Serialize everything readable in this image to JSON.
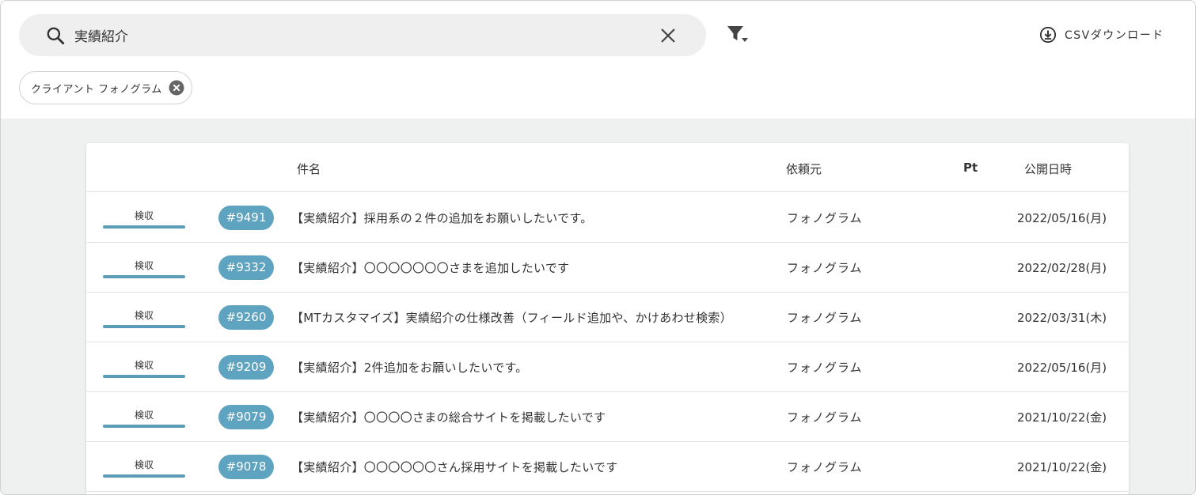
{
  "search": {
    "value": "実績紹介",
    "icon": "search-icon",
    "clear_icon": "close-icon"
  },
  "filter": {
    "icon": "filter-icon"
  },
  "csv": {
    "label": "CSVダウンロード",
    "icon": "download-circle-icon"
  },
  "chips": [
    {
      "label": "クライアント フォノグラム",
      "close_icon": "cancel-circle-icon"
    }
  ],
  "table": {
    "headers": {
      "name": "件名",
      "client": "依頼元",
      "pt": "Pt",
      "date": "公開日時"
    },
    "rows": [
      {
        "status": "検収",
        "id": "#9491",
        "title": "【実績紹介】採用系の２件の追加をお願いしたいです。",
        "client": "フォノグラム",
        "pt": "",
        "date": "2022/05/16(月)"
      },
      {
        "status": "検収",
        "id": "#9332",
        "title": "【実績紹介】〇〇〇〇〇〇〇さまを追加したいです",
        "client": "フォノグラム",
        "pt": "",
        "date": "2022/02/28(月)"
      },
      {
        "status": "検収",
        "id": "#9260",
        "title": "【MTカスタマイズ】実績紹介の仕様改善（フィールド追加や、かけあわせ検索）",
        "client": "フォノグラム",
        "pt": "",
        "date": "2022/03/31(木)"
      },
      {
        "status": "検収",
        "id": "#9209",
        "title": "【実績紹介】2件追加をお願いしたいです。",
        "client": "フォノグラム",
        "pt": "",
        "date": "2022/05/16(月)"
      },
      {
        "status": "検収",
        "id": "#9079",
        "title": "【実績紹介】〇〇〇〇さまの総合サイトを掲載したいです",
        "client": "フォノグラム",
        "pt": "",
        "date": "2021/10/22(金)"
      },
      {
        "status": "検収",
        "id": "#9078",
        "title": "【実績紹介】〇〇〇〇〇〇さん採用サイトを掲載したいです",
        "client": "フォノグラム",
        "pt": "",
        "date": "2021/10/22(金)"
      }
    ]
  },
  "colors": {
    "accent": "#5ea3bf",
    "status_bar": "#5b9db8",
    "background": "#eff1f1"
  }
}
